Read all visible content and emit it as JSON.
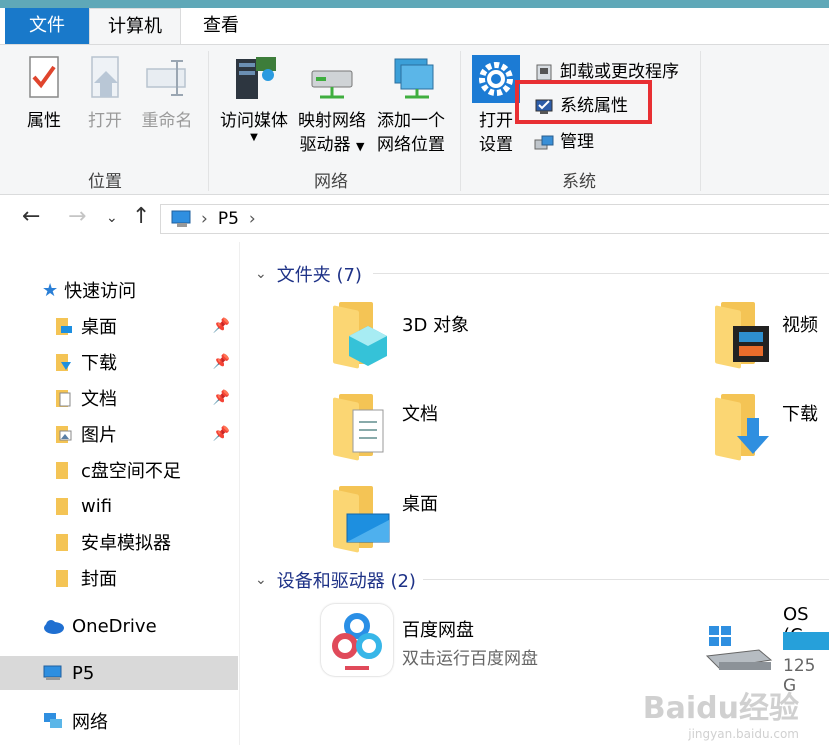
{
  "tabs": [
    {
      "label": "文件"
    },
    {
      "label": "计算机"
    },
    {
      "label": "查看"
    }
  ],
  "ribbon": {
    "location_group": {
      "label": "位置",
      "properties": "属性",
      "open": "打开",
      "rename": "重命名"
    },
    "network_group": {
      "label": "网络",
      "access_media": "访问媒体",
      "map_drive_line1": "映射网络",
      "map_drive_line2": "驱动器",
      "add_location_line1": "添加一个",
      "add_location_line2": "网络位置"
    },
    "system_group": {
      "label": "系统",
      "open_settings_line1": "打开",
      "open_settings_line2": "设置",
      "uninstall": "卸载或更改程序",
      "system_properties": "系统属性",
      "manage": "管理"
    }
  },
  "address": {
    "path": "P5"
  },
  "sidebar": {
    "quick_access": "快速访问",
    "items": [
      {
        "label": "桌面",
        "pinned": true
      },
      {
        "label": "下载",
        "pinned": true
      },
      {
        "label": "文档",
        "pinned": true
      },
      {
        "label": "图片",
        "pinned": true
      },
      {
        "label": "c盘空间不足",
        "pinned": false
      },
      {
        "label": "wifi",
        "pinned": false
      },
      {
        "label": "安卓模拟器",
        "pinned": false
      },
      {
        "label": "封面",
        "pinned": false
      }
    ],
    "onedrive": "OneDrive",
    "this_pc": "P5",
    "network": "网络"
  },
  "content": {
    "folders_header": "文件夹 (7)",
    "folders": [
      {
        "label": "3D 对象"
      },
      {
        "label": "视频"
      },
      {
        "label": "文档"
      },
      {
        "label": "下载"
      },
      {
        "label": "桌面"
      }
    ],
    "devices_header": "设备和驱动器 (2)",
    "devices": [
      {
        "label": "百度网盘",
        "sub": "双击运行百度网盘"
      },
      {
        "label": "OS (C",
        "sub": "125 G"
      }
    ]
  },
  "watermark": {
    "brand": "Baidu经验",
    "url": "jingyan.baidu.com"
  },
  "colors": {
    "file_tab": "#1979ca",
    "accent_bar": "#5fa8b8",
    "highlight": "#e82f33",
    "section_header": "#1e3287",
    "folder_yellow": "#f4c455"
  }
}
